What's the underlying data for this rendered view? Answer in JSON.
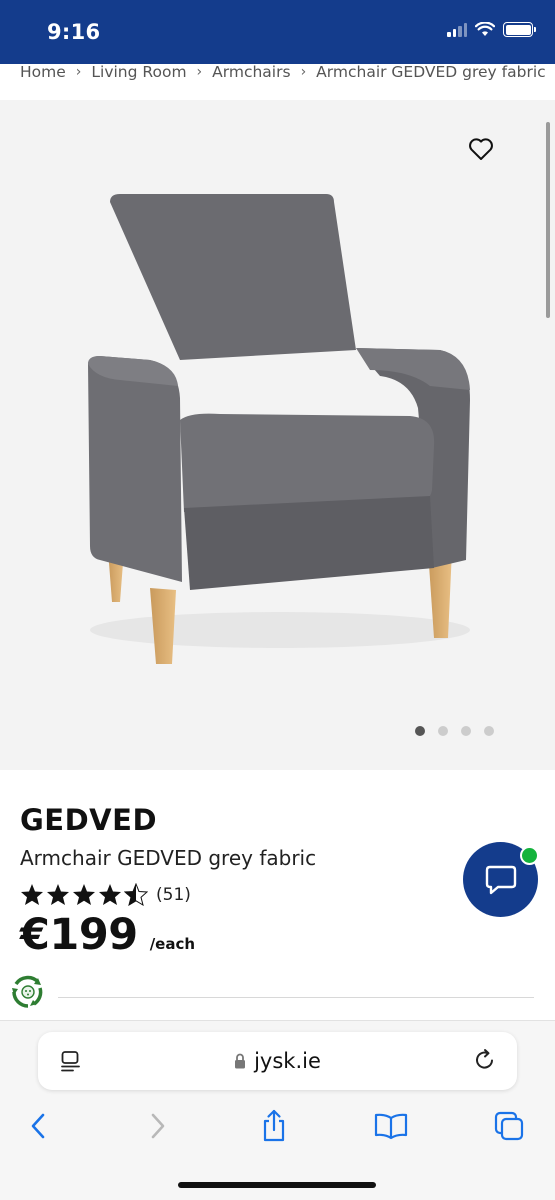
{
  "status_bar": {
    "time": "9:16",
    "background": "#143c8c"
  },
  "breadcrumb": {
    "items": [
      "Home",
      "Living Room",
      "Armchairs",
      "Armchair GEDVED grey fabric"
    ],
    "separator": "›"
  },
  "gallery": {
    "favorite_icon": "heart-icon",
    "image_count": 4,
    "active_image": 1
  },
  "product": {
    "brand": "GEDVED",
    "name": "Armchair GEDVED grey fabric",
    "rating_stars": 4.5,
    "review_count": "(51)",
    "price": "€199",
    "price_unit": "/each"
  },
  "chat": {
    "icon": "chat-bubble-icon",
    "color": "#143c8c",
    "online_color": "#14b33c"
  },
  "eco_icon": "eco-badge-icon",
  "browser": {
    "url": "jysk.ie",
    "lock_icon": "lock-icon",
    "reader_icon": "reader-icon",
    "reload_icon": "reload-icon",
    "toolbar": [
      "back-icon",
      "forward-icon",
      "share-icon",
      "bookmarks-icon",
      "tabs-icon"
    ],
    "accent": "#1a73e8"
  }
}
